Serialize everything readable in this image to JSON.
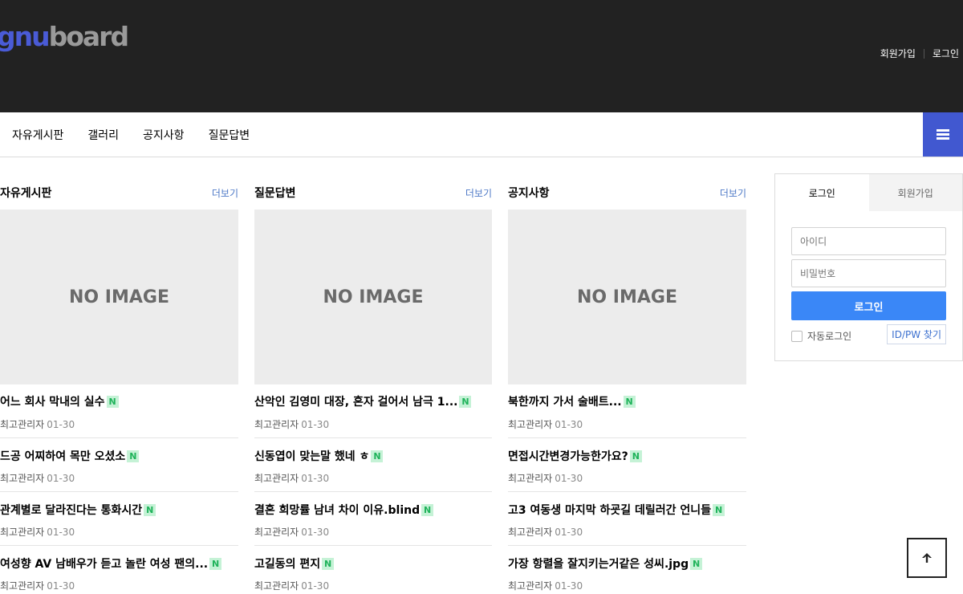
{
  "header": {
    "logo_gnu": "gnu",
    "logo_board": "board",
    "links": {
      "join": "회원가입",
      "login": "로그인"
    }
  },
  "nav": {
    "items": [
      "자유게시판",
      "갤러리",
      "공지사항",
      "질문답변"
    ]
  },
  "columns": [
    {
      "title": "자유게시판",
      "more": "더보기",
      "thumb": "NO IMAGE",
      "posts": [
        {
          "title": "어느 회사 막내의 실수",
          "badge": "N",
          "author": "최고관리자",
          "date": "01-30"
        },
        {
          "title": "드공 어찌하여 목만 오셨소",
          "badge": "N",
          "author": "최고관리자",
          "date": "01-30"
        },
        {
          "title": "관계별로 달라진다는 통화시간",
          "badge": "N",
          "author": "최고관리자",
          "date": "01-30"
        },
        {
          "title": "여성향 AV 남배우가 듣고 놀란 여성 팬의...",
          "badge": "N",
          "author": "최고관리자",
          "date": "01-30"
        }
      ]
    },
    {
      "title": "질문답변",
      "more": "더보기",
      "thumb": "NO IMAGE",
      "posts": [
        {
          "title": "산악인 김영미 대장, 혼자 걸어서 남극 1...",
          "badge": "N",
          "author": "최고관리자",
          "date": "01-30"
        },
        {
          "title": "신동엽이 맞는말 했네 ㅎ",
          "badge": "N",
          "author": "최고관리자",
          "date": "01-30"
        },
        {
          "title": "결혼 희망률 남녀 차이 이유.blind",
          "badge": "N",
          "author": "최고관리자",
          "date": "01-30"
        },
        {
          "title": "고길동의 편지",
          "badge": "N",
          "author": "최고관리자",
          "date": "01-30"
        }
      ]
    },
    {
      "title": "공지사항",
      "more": "더보기",
      "thumb": "NO IMAGE",
      "posts": [
        {
          "title": "북한까지 가서 술배트...",
          "badge": "N",
          "author": "최고관리자",
          "date": "01-30"
        },
        {
          "title": "면접시간변경가능한가요?",
          "badge": "N",
          "author": "최고관리자",
          "date": "01-30"
        },
        {
          "title": "고3 여동생 마지막 하굣길 데릴러간 언니들",
          "badge": "N",
          "author": "최고관리자",
          "date": "01-30"
        },
        {
          "title": "가장 항렬을 잘지키는거같은 성씨.jpg",
          "badge": "N",
          "author": "최고관리자",
          "date": "01-30"
        }
      ]
    }
  ],
  "login_box": {
    "tab_login": "로그인",
    "tab_join": "회원가입",
    "id_placeholder": "아이디",
    "pw_placeholder": "비밀번호",
    "submit": "로그인",
    "auto_login": "자동로그인",
    "find": "ID/PW 찾기"
  },
  "colors": {
    "header_bg": "#222222",
    "accent": "#4158d0",
    "login_button": "#3a87f7",
    "badge_bg": "#c5f2d6",
    "badge_text": "#1fb35a"
  },
  "icons": {
    "menu": "hamburger-icon",
    "top": "arrow-up-icon"
  }
}
